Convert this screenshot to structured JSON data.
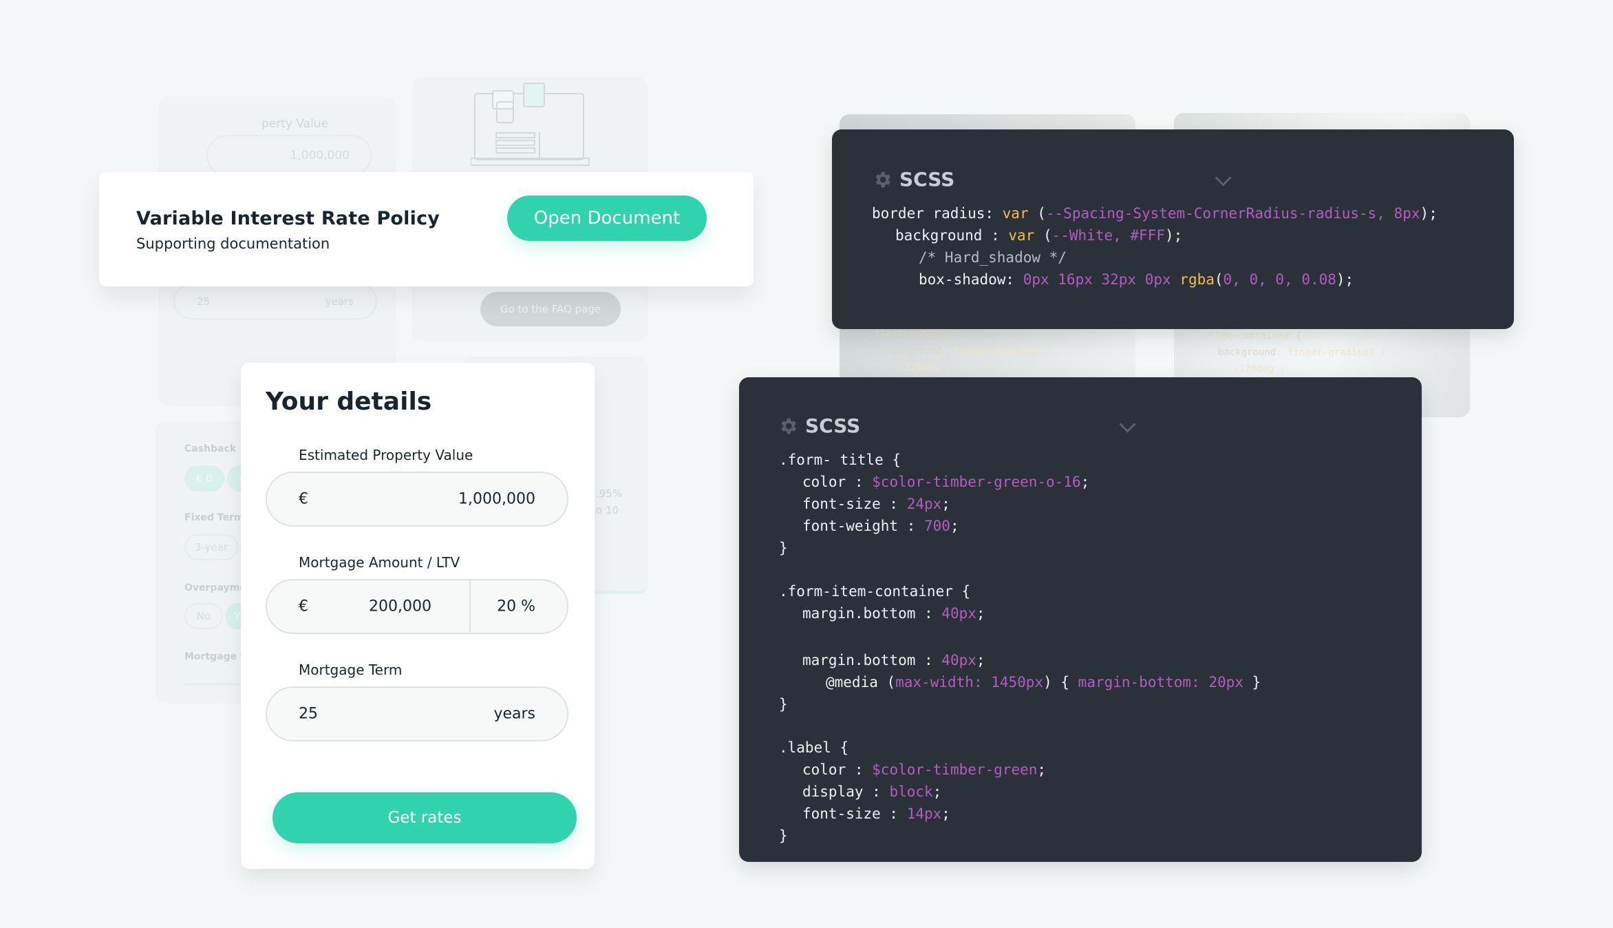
{
  "background": {
    "top_left_form": {
      "label_fragment": "perty Value",
      "value": "1,000,000",
      "term_value": "25",
      "term_unit": "years"
    },
    "filters": {
      "cashback_label": "Cashback",
      "cashback_options": [
        "€ 0",
        "€"
      ],
      "fixed_term_label": "Fixed Term",
      "fixed_term_option": "3-year",
      "overpayments_label": "Overpaymen",
      "overpayment_options": [
        "No",
        "Y"
      ],
      "mortgage_term_label": "Mortgage te"
    },
    "faq": {
      "button_label": "Go to the FAQ page"
    },
    "rate_panel": {
      "line1": ".95%",
      "line2": "o 10"
    },
    "code_panels": [
      {
        "selector": ".flex-container {",
        "prop": "background",
        "fn": ": linear-gradient (",
        "arg": "-120deg ,"
      },
      {
        "selector": ".flex-container {",
        "prop": "background",
        "fn": ": linear-gradient (",
        "arg": "-120deg ,"
      }
    ]
  },
  "info_card": {
    "title": "Variable Interest Rate Policy",
    "subtitle": "Supporting documentation",
    "button_label": "Open Document"
  },
  "details_form": {
    "title": "Your details",
    "property_value": {
      "label": "Estimated Property Value",
      "currency": "€",
      "value": "1,000,000"
    },
    "mortgage_amount": {
      "label": "Mortgage Amount / LTV",
      "currency": "€",
      "value": "200,000",
      "ltv": "20 %"
    },
    "mortgage_term": {
      "label": "Mortgage Term",
      "value": "25",
      "unit": "years"
    },
    "submit_label": "Get rates"
  },
  "code_card_1": {
    "language": "SCSS",
    "lines": [
      {
        "a": "border radius: ",
        "b": "var",
        "c": " (",
        "d": "--Spacing-System-CornerRadius-radius-s, 8px",
        "e": ");"
      },
      {
        "a": "background",
        "b": " : ",
        "c": "var",
        "d": " (",
        "e": "--White, #FFF",
        "f": ");"
      },
      {
        "comment": "/* Hard_shadow */"
      },
      {
        "a": "box-shadow: ",
        "b": "0px 16px 32px 0px ",
        "c": "rgba",
        "d": "(",
        "e": "0, 0, 0, 0.08",
        "f": ");"
      }
    ]
  },
  "code_card_2": {
    "language": "SCSS",
    "lines": [
      {
        "text": ".form- title {"
      },
      {
        "prop": "color : ",
        "val": "$color-timber-green-o-16",
        "end": ";"
      },
      {
        "prop": "font-size : ",
        "val": "24px",
        "end": ";"
      },
      {
        "prop": "font-weight : ",
        "val": "700",
        "end": ";"
      },
      {
        "text": "}"
      },
      {
        "text": ".form-item-container {"
      },
      {
        "prop": "margin.bottom : ",
        "val": "40px",
        "end": ";"
      },
      {
        "prop": "margin.bottom : ",
        "val": "40px",
        "end": ";"
      },
      {
        "media_kw": "@media (",
        "media_q": "max-width: 1450px",
        "media_mid": ") { ",
        "media_rule": "margin-bottom: 20px",
        "media_end": " }"
      },
      {
        "text": "}"
      },
      {
        "text": ".label {"
      },
      {
        "prop": "color : ",
        "val": "$color-timber-green",
        "end": ";"
      },
      {
        "prop": "display : ",
        "val": "block",
        "end": ";"
      },
      {
        "prop": "font-size : ",
        "val": "14px",
        "end": ";"
      },
      {
        "text": "}"
      }
    ]
  },
  "colors": {
    "accent": "#31d2ae",
    "code_bg": "#2b3139",
    "code_value": "#b35cc2",
    "code_keyword": "#f2be4a",
    "text_dark": "#17262e",
    "page_bg": "#f4f7f8"
  }
}
